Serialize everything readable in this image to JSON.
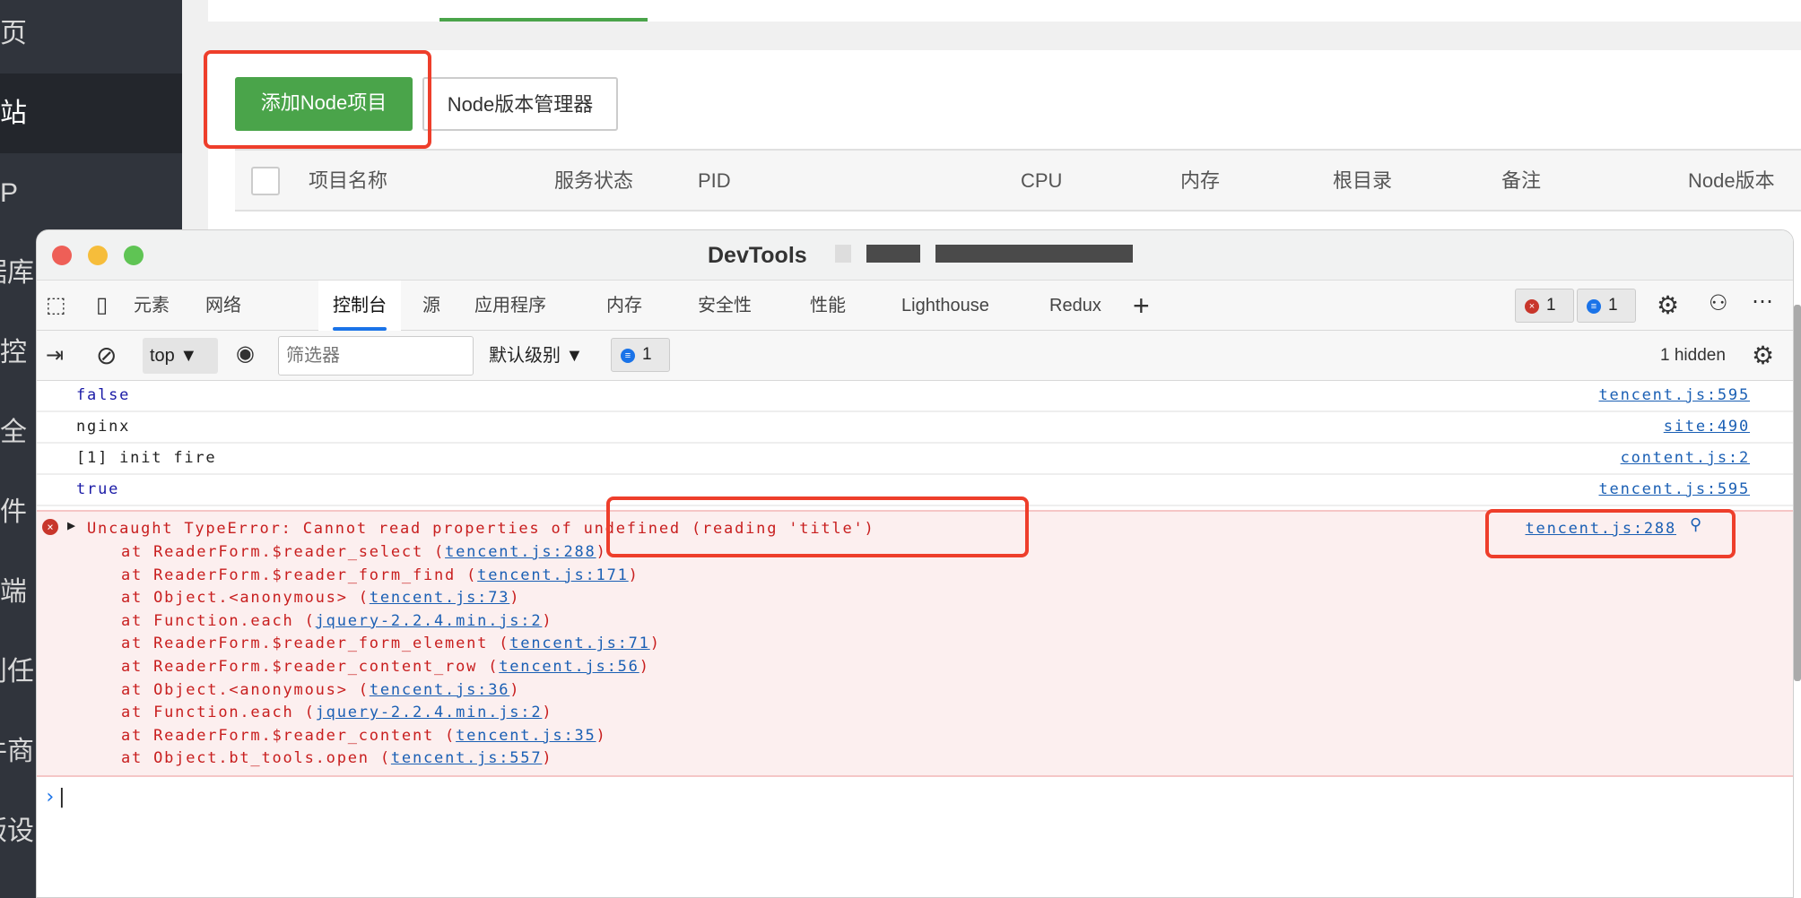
{
  "sidebar": {
    "items": [
      {
        "label": "页"
      },
      {
        "label": "站"
      },
      {
        "label": "P"
      },
      {
        "label": "据库"
      },
      {
        "label": "控"
      },
      {
        "label": "全"
      },
      {
        "label": "件"
      },
      {
        "label": "端"
      },
      {
        "label": "划任"
      },
      {
        "label": "件商"
      },
      {
        "label": "版设"
      }
    ],
    "active_index": 1
  },
  "panel": {
    "add_button": "添加Node项目",
    "version_button": "Node版本管理器",
    "columns": [
      "项目名称",
      "服务状态",
      "PID",
      "CPU",
      "内存",
      "根目录",
      "备注",
      "Node版本"
    ]
  },
  "devtools": {
    "title": "DevTools",
    "tabs": [
      "元素",
      "网络",
      "控制台",
      "源",
      "应用程序",
      "内存",
      "安全性",
      "性能",
      "Lighthouse",
      "Redux"
    ],
    "active_tab": "控制台",
    "error_count": "1",
    "info_count": "1",
    "context": "top",
    "filter_placeholder": "筛选器",
    "level": "默认级别",
    "filter_info_count": "1",
    "hidden": "1 hidden",
    "logs": [
      {
        "text": "false",
        "source": "tencent.js:595",
        "color": "#1a1aa6"
      },
      {
        "text": "nginx",
        "source": "site:490",
        "color": "#222222"
      },
      {
        "text": "[1] init fire",
        "source": "content.js:2",
        "color": "#222222"
      },
      {
        "text": "true",
        "source": "tencent.js:595",
        "color": "#1a1aa6"
      }
    ],
    "error": {
      "message": "Uncaught TypeError: Cannot read properties of undefined (reading 'title')",
      "source": "tencent.js:288",
      "stack": [
        {
          "fn": "at ReaderForm.$reader_select",
          "loc": "tencent.js:288"
        },
        {
          "fn": "at ReaderForm.$reader_form_find",
          "loc": "tencent.js:171"
        },
        {
          "fn": "at Object.<anonymous>",
          "loc": "tencent.js:73"
        },
        {
          "fn": "at Function.each",
          "loc": "jquery-2.2.4.min.js:2"
        },
        {
          "fn": "at ReaderForm.$reader_form_element",
          "loc": "tencent.js:71"
        },
        {
          "fn": "at ReaderForm.$reader_content_row",
          "loc": "tencent.js:56"
        },
        {
          "fn": "at Object.<anonymous>",
          "loc": "tencent.js:36"
        },
        {
          "fn": "at Function.each",
          "loc": "jquery-2.2.4.min.js:2"
        },
        {
          "fn": "at ReaderForm.$reader_content",
          "loc": "tencent.js:35"
        },
        {
          "fn": "at Object.bt_tools.open",
          "loc": "tencent.js:557"
        }
      ]
    },
    "prompt": "›"
  },
  "colors": {
    "accent_green": "#4aa44a",
    "annotation_red": "#ee3e2b",
    "error_red": "#c81e1e",
    "link_blue": "#1a5fb4"
  }
}
